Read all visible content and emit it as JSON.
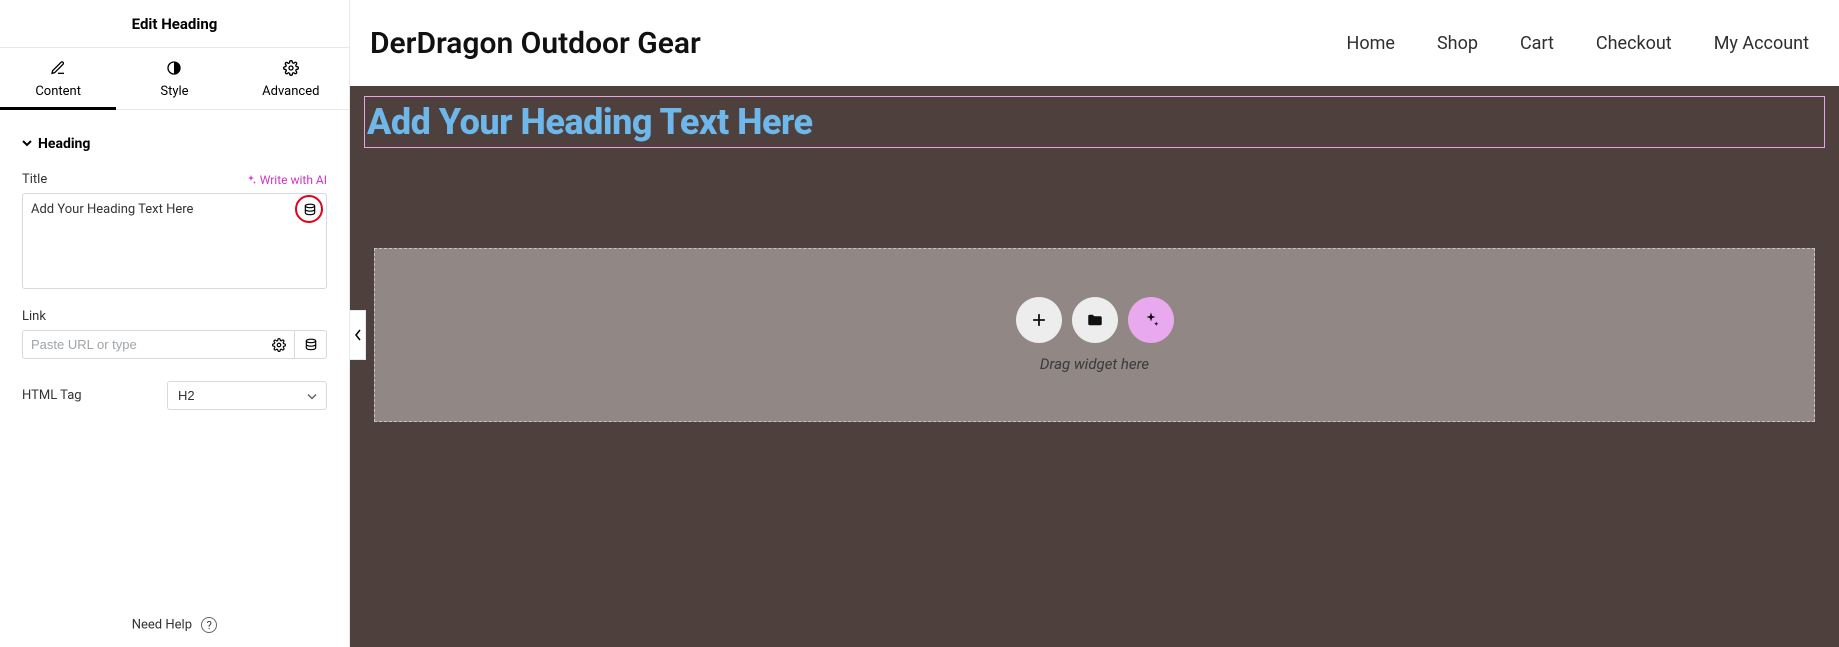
{
  "sidebar": {
    "header": "Edit Heading",
    "tabs": {
      "content": "Content",
      "style": "Style",
      "advanced": "Advanced"
    },
    "section_title": "Heading",
    "title_label": "Title",
    "write_ai": "Write with AI",
    "title_value": "Add Your Heading Text Here",
    "link_label": "Link",
    "link_placeholder": "Paste URL or type",
    "htmltag_label": "HTML Tag",
    "htmltag_value": "H2",
    "need_help": "Need Help"
  },
  "preview": {
    "brand": "DerDragon Outdoor Gear",
    "nav": {
      "home": "Home",
      "shop": "Shop",
      "cart": "Cart",
      "checkout": "Checkout",
      "account": "My Account"
    },
    "heading_text": "Add Your Heading Text Here",
    "drag_text": "Drag widget here"
  }
}
